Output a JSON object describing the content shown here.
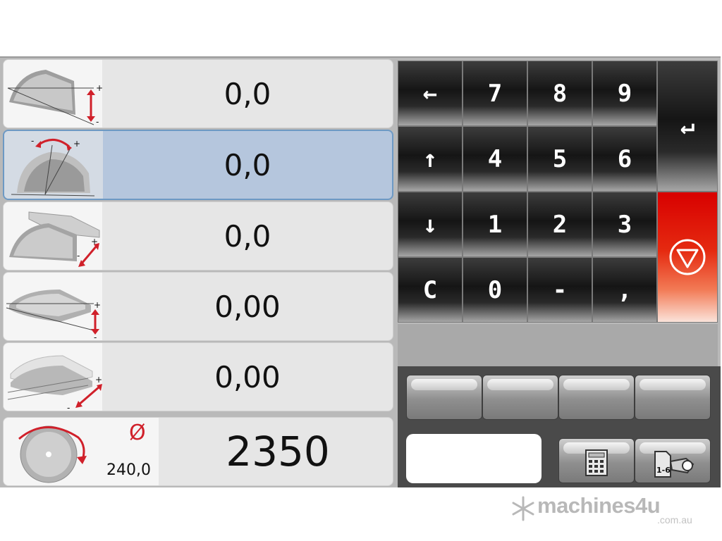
{
  "params": {
    "rows": [
      {
        "value": "0,0",
        "icon": "blade-height-icon"
      },
      {
        "value": "0,0",
        "icon": "blade-tilt-icon",
        "selected": true
      },
      {
        "value": "0,0",
        "icon": "fence-position-icon"
      },
      {
        "value": "0,00",
        "icon": "scoring-height-icon"
      },
      {
        "value": "0,00",
        "icon": "scoring-width-icon"
      }
    ],
    "speed": {
      "diameter_symbol": "Ø",
      "diameter": "240,0",
      "rpm": "2350"
    }
  },
  "keypad": {
    "backspace": "←",
    "up": "↑",
    "down": "↓",
    "enter": "↵",
    "clear": "C",
    "digits": {
      "seven": "7",
      "eight": "8",
      "nine": "9",
      "four": "4",
      "five": "5",
      "six": "6",
      "one": "1",
      "two": "2",
      "three": "3",
      "zero": "0"
    },
    "minus": "-",
    "comma": ","
  },
  "colors": {
    "selected_row": "#b5c6dd",
    "stop_key": "#d80000",
    "arrow_red": "#d0202a"
  },
  "watermark": {
    "brand": "machines4u",
    "domain": ".com.au"
  }
}
